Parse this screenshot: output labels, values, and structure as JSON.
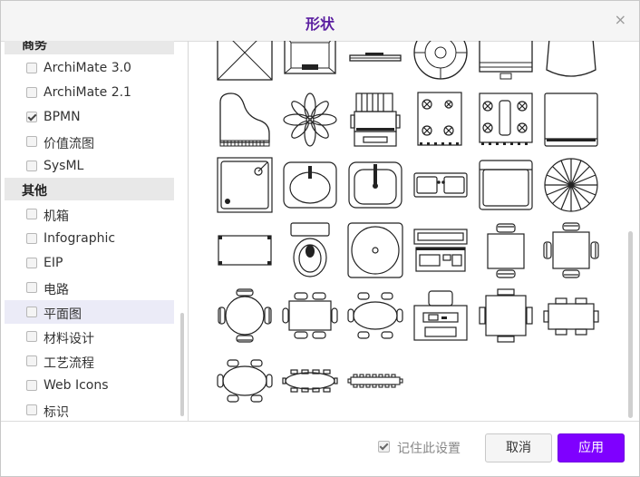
{
  "dialog": {
    "title": "形状",
    "close_glyph": "×"
  },
  "sidebar": {
    "partial_header": "商务",
    "groups": [
      {
        "items": [
          {
            "label": "ArchiMate 3.0",
            "checked": false
          },
          {
            "label": "ArchiMate 2.1",
            "checked": false
          },
          {
            "label": "BPMN",
            "checked": true
          },
          {
            "label": "价值流图",
            "checked": false
          },
          {
            "label": "SysML",
            "checked": false
          }
        ]
      },
      {
        "header": "其他",
        "items": [
          {
            "label": "机箱",
            "checked": false
          },
          {
            "label": "Infographic",
            "checked": false
          },
          {
            "label": "EIP",
            "checked": false
          },
          {
            "label": "电路",
            "checked": false
          },
          {
            "label": "平面图",
            "checked": false,
            "selected": true
          },
          {
            "label": "材料设计",
            "checked": false
          },
          {
            "label": "工艺流程",
            "checked": false
          },
          {
            "label": "Web Icons",
            "checked": false
          },
          {
            "label": "标识",
            "checked": false
          }
        ]
      }
    ]
  },
  "shapes": [
    "crossed-box-shape",
    "stair-shape",
    "shelf-shape",
    "dartboard-shape",
    "laptop-shape",
    "chair-shape",
    "piano-shape",
    "plant-shape",
    "copier-shape",
    "stove-shape",
    "range-shape",
    "fridge-shape",
    "shower-shape",
    "oval-sink-shape",
    "square-sink-shape",
    "double-sink-shape",
    "bathtub-shape",
    "umbrella-shape",
    "rug-shape",
    "toilet-shape",
    "round-sink-shape",
    "dresser-shape",
    "small-table-shape",
    "square-table-shape",
    "round-table-shape",
    "rect-table-shape",
    "oval-table-shape",
    "desk-shape",
    "table-4-shape",
    "table-2-shape",
    "oval-table-small-shape",
    "long-table-shape",
    "banquet-table-shape"
  ],
  "footer": {
    "remember_label": "记住此设置",
    "remember_checked": true,
    "cancel_label": "取消",
    "apply_label": "应用"
  },
  "colors": {
    "title": "#5a1ea0",
    "apply_bg": "#7f00ff"
  }
}
